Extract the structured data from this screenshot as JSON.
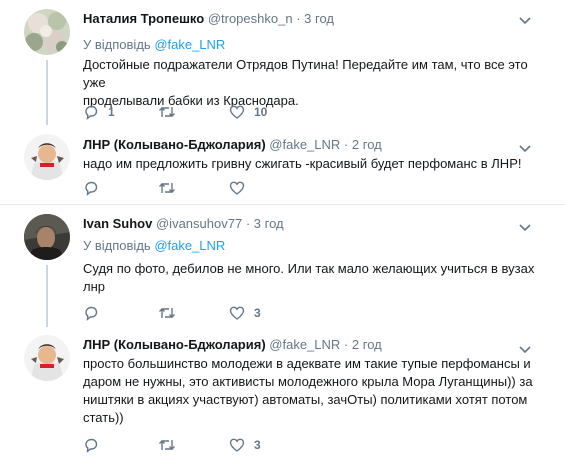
{
  "tweets": [
    {
      "name": "Наталия Тропешко",
      "handle": "@tropeshko_n",
      "dot": "·",
      "time": "3 год",
      "reply_prefix": "У відповідь",
      "reply_mention": "@fake_LNR",
      "text_lines": [
        "Достойные подражатели Отрядов Путина! Передайте им там, что все это уже",
        "проделывали бабки из Краснодара."
      ],
      "reply_count": "1",
      "retweet_count": "",
      "like_count": "10"
    },
    {
      "name": "ЛНР (Колывано-Бджолария)",
      "handle": "@fake_LNR",
      "dot": "·",
      "time": "2 год",
      "text_lines": [
        "надо им предложить гривну сжигать -красивый будет перфоманс в ЛНР!"
      ],
      "reply_count": "",
      "retweet_count": "",
      "like_count": ""
    },
    {
      "name": "Ivan Suhov",
      "handle": "@ivansuhov77",
      "dot": "·",
      "time": "3 год",
      "reply_prefix": "У відповідь",
      "reply_mention": "@fake_LNR",
      "text_lines": [
        "Судя по фото, дебилов не много. Или так мало желающих учиться в вузах",
        "лнр"
      ],
      "reply_count": "",
      "retweet_count": "",
      "like_count": "3"
    },
    {
      "name": "ЛНР (Колывано-Бджолария)",
      "handle": "@fake_LNR",
      "dot": "·",
      "time": "2 год",
      "text_lines": [
        "просто большинство молодежи в адеквате им такие тупые перфомансы  и",
        "даром не нужны, это активисты молодежного крыла Мора Луганщины)) за",
        "ништяки в акциях участвуют) автоматы, зачОты) политиками хотят потом",
        "стать))"
      ],
      "reply_count": "",
      "retweet_count": "",
      "like_count": "3"
    }
  ],
  "icons": {
    "reply": "reply-icon",
    "retweet": "retweet-icon",
    "like": "heart-icon",
    "menu": "chevron-down-icon"
  },
  "colors": {
    "link": "#1da1f2",
    "muted": "#657786",
    "text": "#14171a",
    "thread": "#ccd6dd"
  }
}
